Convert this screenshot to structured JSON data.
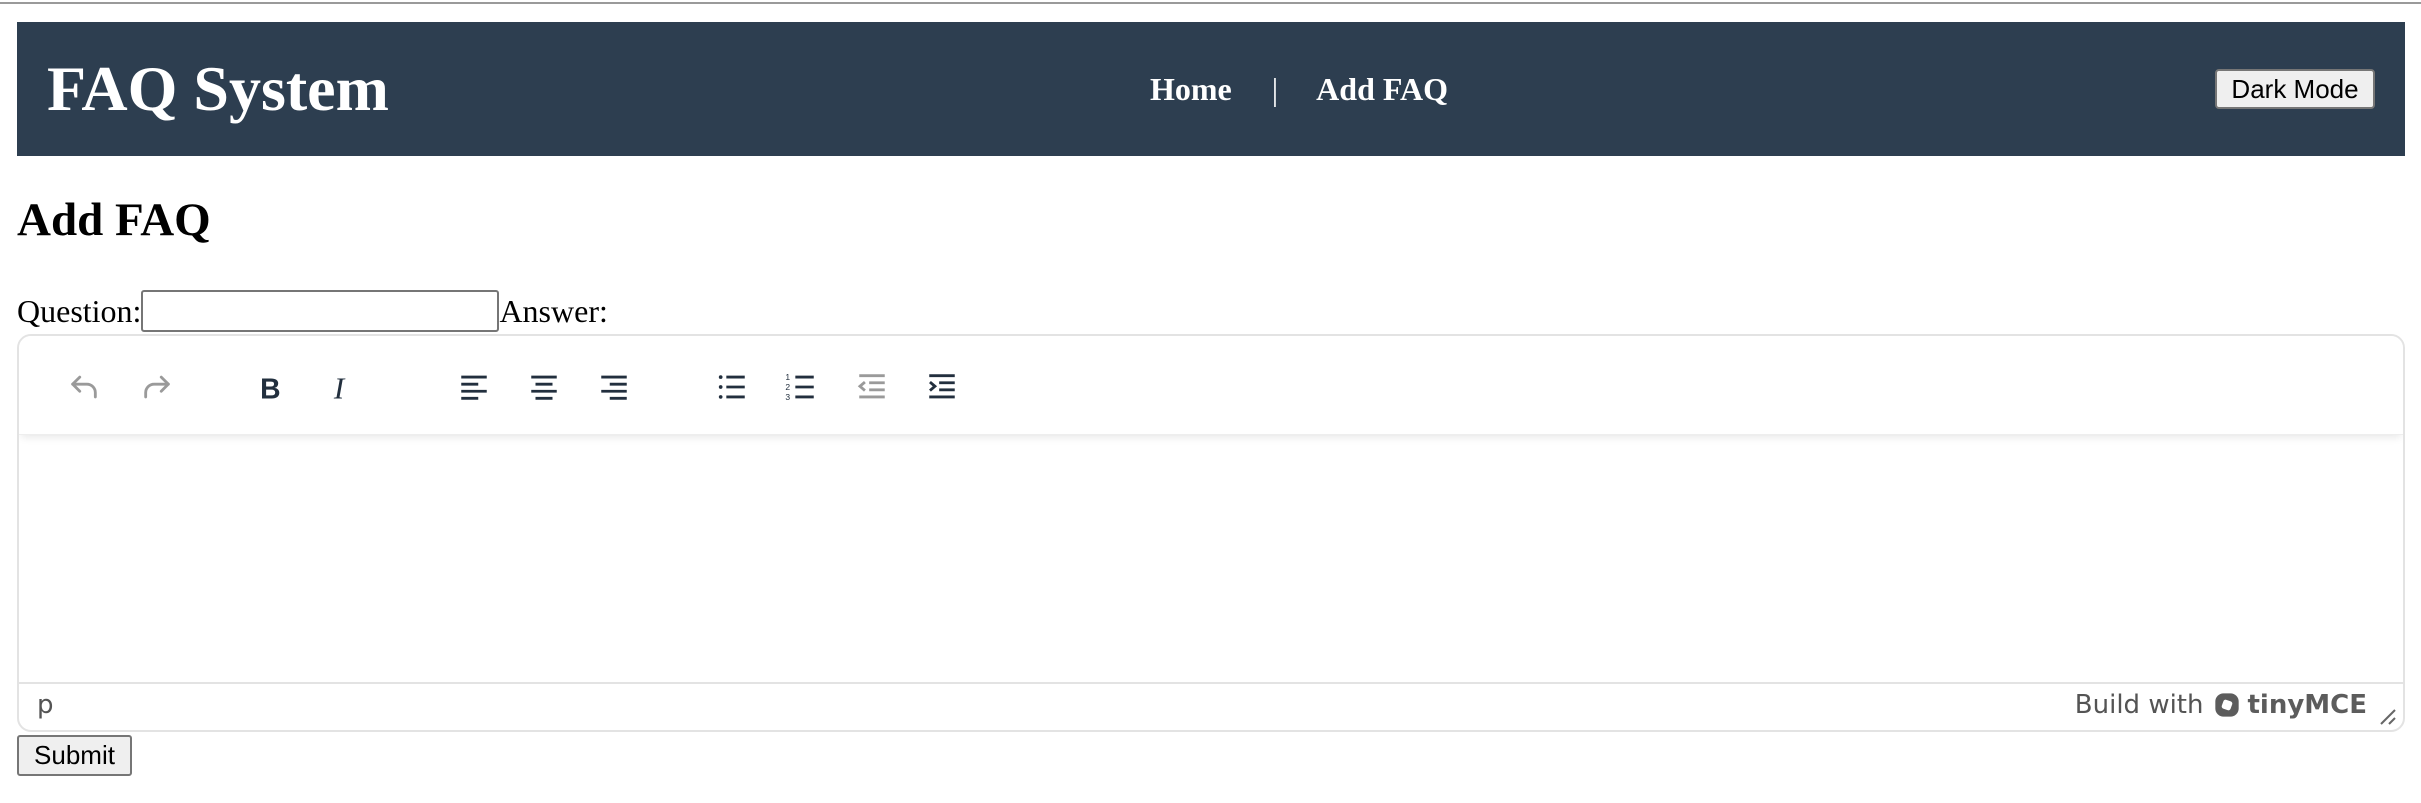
{
  "header": {
    "brand": "FAQ System",
    "nav": {
      "home": "Home",
      "separator": "|",
      "add_faq": "Add FAQ"
    },
    "dark_mode_label": "Dark Mode",
    "background_color": "#2d3e50"
  },
  "page": {
    "title": "Add FAQ"
  },
  "form": {
    "question_label": "Question:",
    "question_value": "",
    "answer_label": "Answer:",
    "submit_label": "Submit"
  },
  "editor": {
    "toolbar": [
      {
        "name": "undo-icon",
        "state": "disabled"
      },
      {
        "name": "redo-icon",
        "state": "disabled"
      },
      {
        "name": "bold-icon",
        "state": "enabled"
      },
      {
        "name": "italic-icon",
        "state": "enabled"
      },
      {
        "name": "align-left-icon",
        "state": "enabled"
      },
      {
        "name": "align-center-icon",
        "state": "enabled"
      },
      {
        "name": "align-right-icon",
        "state": "enabled"
      },
      {
        "name": "bullet-list-icon",
        "state": "enabled"
      },
      {
        "name": "numbered-list-icon",
        "state": "enabled"
      },
      {
        "name": "outdent-icon",
        "state": "disabled"
      },
      {
        "name": "indent-icon",
        "state": "enabled"
      }
    ],
    "content": "",
    "statusbar": {
      "path": "p",
      "branding_prefix": "Build with",
      "branding_name": "tinyMCE"
    }
  }
}
